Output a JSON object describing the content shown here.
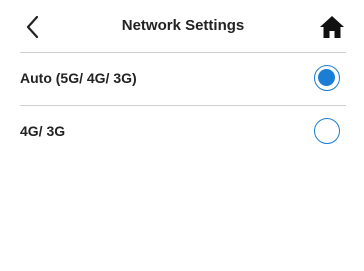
{
  "header": {
    "title": "Network Settings",
    "back_icon": "chevron-left-icon",
    "home_icon": "home-icon"
  },
  "options": [
    {
      "label": "Auto (5G/ 4G/ 3G)",
      "selected": true
    },
    {
      "label": "4G/ 3G",
      "selected": false
    }
  ],
  "colors": {
    "accent": "#1a7fd4",
    "text": "#222222",
    "divider": "#cfcfcf"
  }
}
